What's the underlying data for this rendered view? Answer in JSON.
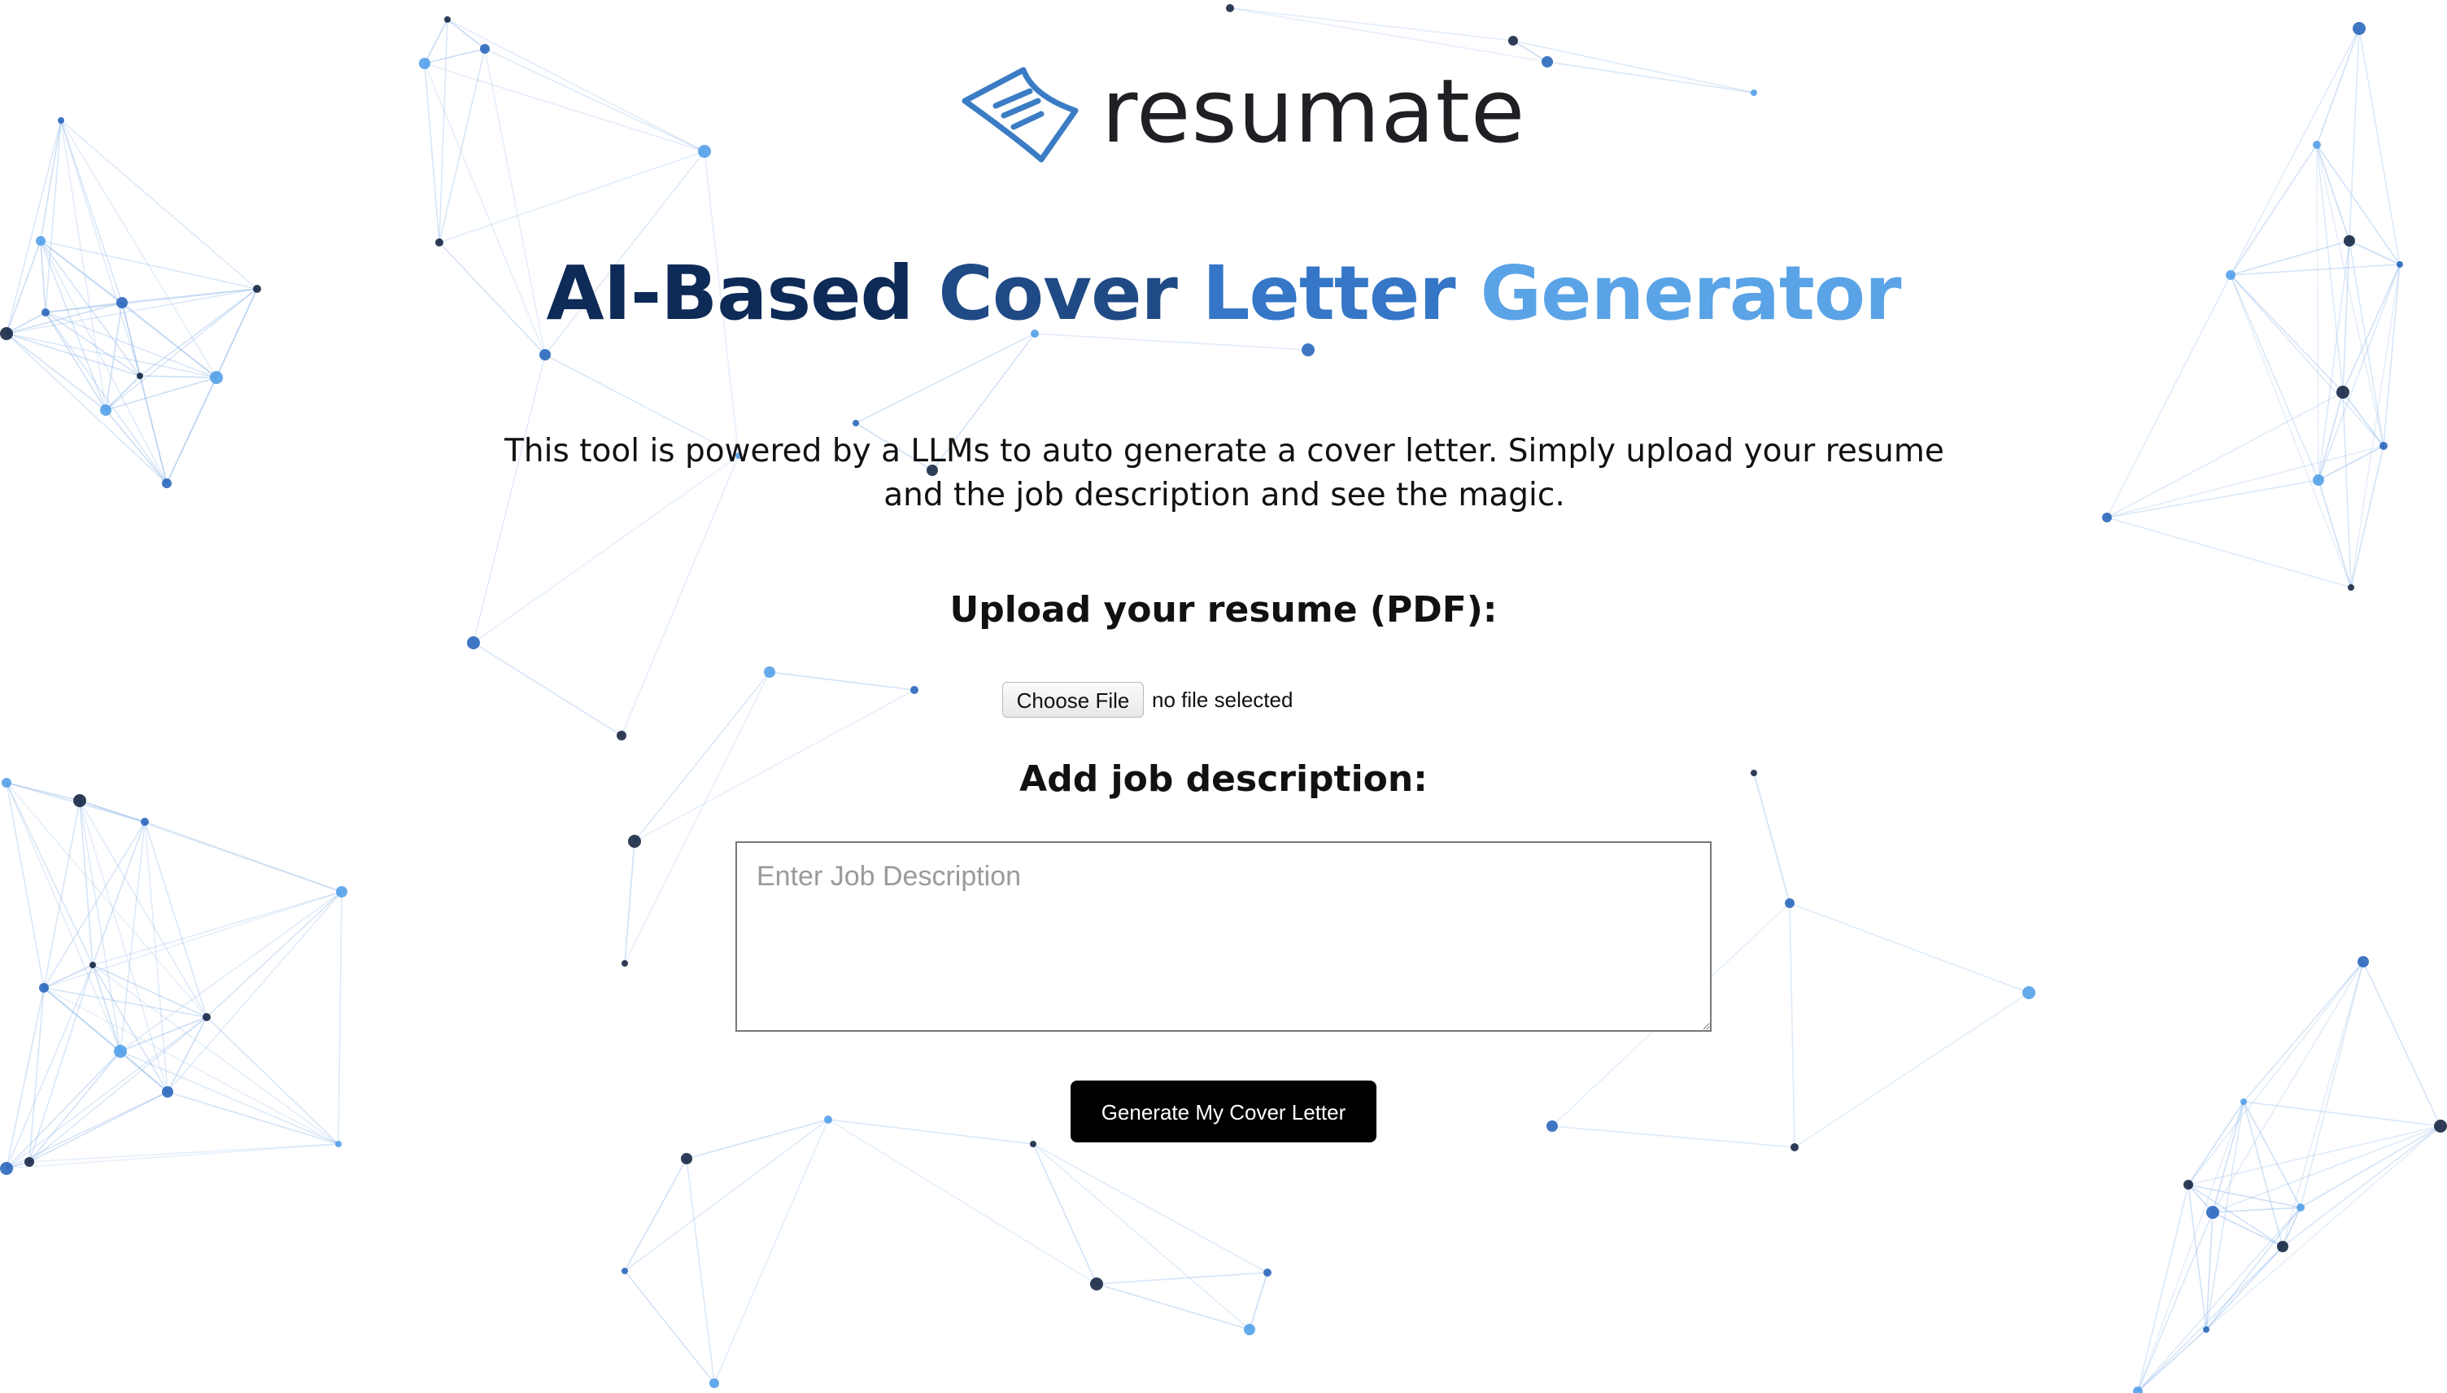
{
  "brand": {
    "name": "resumate",
    "logo_icon": "paper-note-icon",
    "logo_color": "#3b7cc4"
  },
  "title": {
    "word1": "AI-Based",
    "word2": "Cover",
    "word3": "Letter",
    "word4": "Generator",
    "gradient_colors": [
      "#0e2a57",
      "#204a85",
      "#3676c7",
      "#5aa3e6"
    ]
  },
  "description": "This tool is powered by a LLMs to auto generate a cover letter. Simply upload your resume and the job description and see the magic.",
  "resume_upload": {
    "label": "Upload your resume (PDF):",
    "button_label": "Choose File",
    "status": "no file selected"
  },
  "job_description": {
    "label": "Add job description:",
    "placeholder": "Enter Job Description",
    "value": ""
  },
  "generate_button": {
    "label": "Generate My Cover Letter",
    "background": "#000000"
  },
  "background": {
    "style": "network-graph",
    "node_colors": [
      "#1e5fb8",
      "#4a9be8",
      "#0b1b3a"
    ],
    "edge_color": "#8fb8e8"
  }
}
